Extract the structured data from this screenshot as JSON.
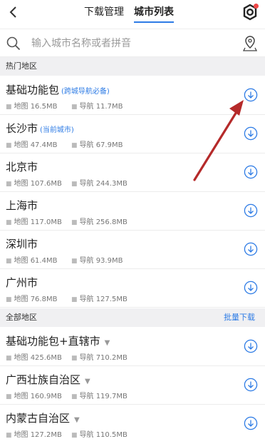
{
  "tabs": [
    "下载管理",
    "城市列表"
  ],
  "search": {
    "placeholder": "输入城市名称或者拼音"
  },
  "sections": {
    "hot": "热门地区",
    "all": "全部地区",
    "batch_download": "批量下载"
  },
  "hot_rows": [
    {
      "name": "基础功能包",
      "tag": "(跨城导航必备)",
      "map": "地图 16.5MB",
      "nav": "导航 11.7MB"
    },
    {
      "name": "长沙市",
      "tag": "(当前城市)",
      "map": "地图 47.4MB",
      "nav": "导航 67.9MB"
    },
    {
      "name": "北京市",
      "map": "地图 107.6MB",
      "nav": "导航 244.3MB"
    },
    {
      "name": "上海市",
      "map": "地图 117.0MB",
      "nav": "导航 256.8MB"
    },
    {
      "name": "深圳市",
      "map": "地图 61.4MB",
      "nav": "导航 93.9MB"
    },
    {
      "name": "广州市",
      "map": "地图 76.8MB",
      "nav": "导航 127.5MB"
    }
  ],
  "all_rows": [
    {
      "name": "基础功能包+直辖市",
      "map": "地图 425.6MB",
      "nav": "导航 710.2MB"
    },
    {
      "name": "广西壮族自治区",
      "map": "地图 160.9MB",
      "nav": "导航 119.7MB"
    },
    {
      "name": "内蒙古自治区",
      "map": "地图 127.2MB",
      "nav": "导航 110.5MB"
    }
  ],
  "colors": {
    "accent": "#2d7be5",
    "annotation_arrow": "#b52a2a",
    "badge": "#f04848"
  },
  "icons": [
    "back-icon",
    "settings-icon",
    "search-icon",
    "location-pin-icon",
    "download-icon",
    "chevron-down-icon"
  ]
}
